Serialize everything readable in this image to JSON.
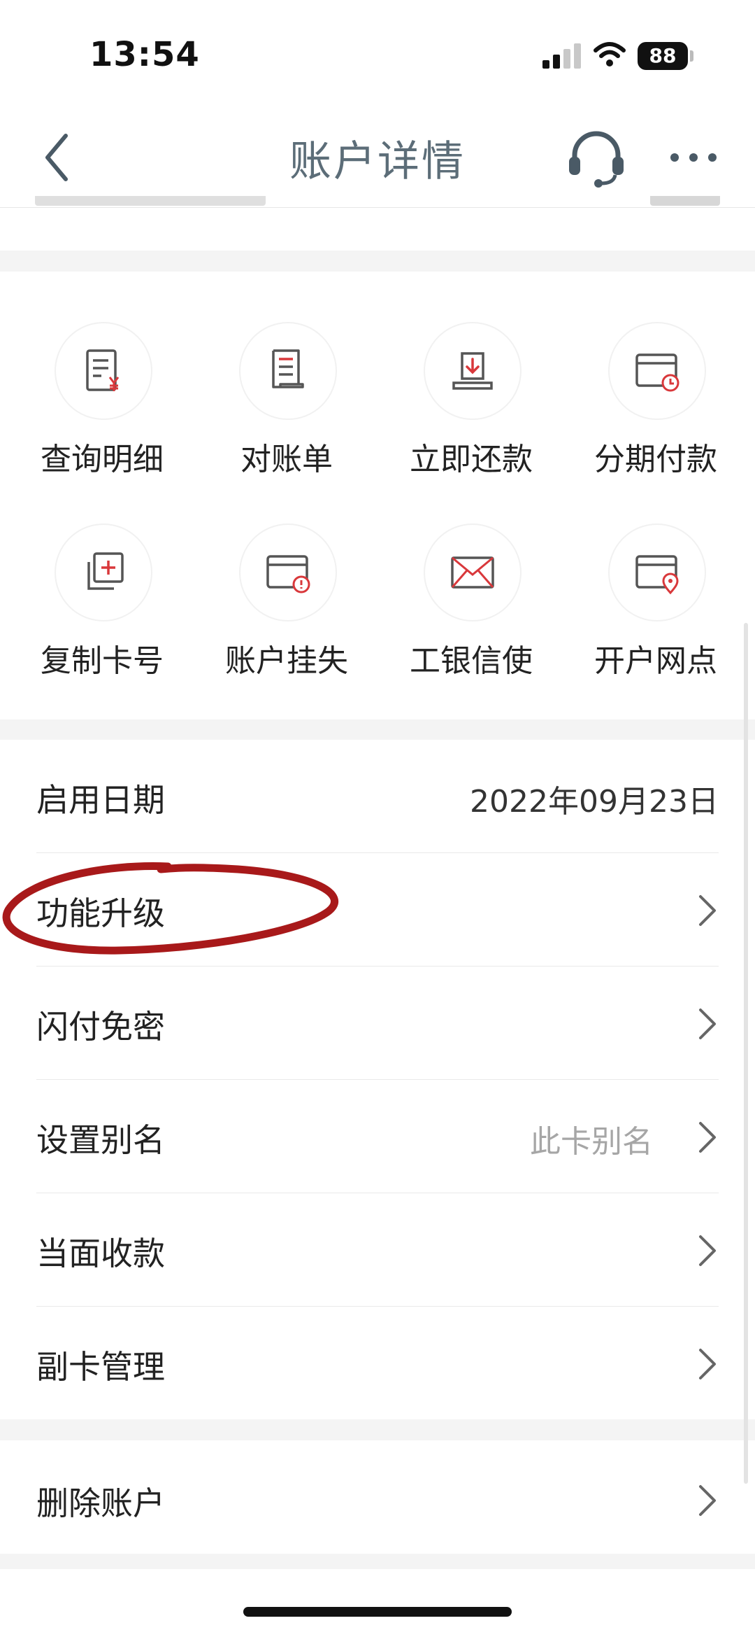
{
  "status_bar": {
    "time": "13:54",
    "battery": "88"
  },
  "nav": {
    "title": "账户详情",
    "back_icon": "chevron-left-icon",
    "support_icon": "headset-icon",
    "more_icon": "more-dots-icon"
  },
  "quick_actions": [
    {
      "label": "查询明细",
      "icon": "statement-yuan-icon"
    },
    {
      "label": "对账单",
      "icon": "bill-document-icon"
    },
    {
      "label": "立即还款",
      "icon": "repay-download-icon"
    },
    {
      "label": "分期付款",
      "icon": "card-clock-icon"
    },
    {
      "label": "复制卡号",
      "icon": "copy-plus-icon"
    },
    {
      "label": "账户挂失",
      "icon": "card-alert-icon"
    },
    {
      "label": "工银信使",
      "icon": "envelope-icon"
    },
    {
      "label": "开户网点",
      "icon": "card-location-icon"
    }
  ],
  "details": {
    "start_date": {
      "label": "启用日期",
      "value": "2022年09月23日"
    },
    "upgrade": {
      "label": "功能升级"
    },
    "flash_pay": {
      "label": "闪付免密"
    },
    "alias": {
      "label": "设置别名",
      "hint": "此卡别名"
    },
    "collect": {
      "label": "当面收款"
    },
    "sub_card": {
      "label": "副卡管理"
    },
    "delete": {
      "label": "删除账户"
    }
  },
  "colors": {
    "accent_red": "#d9383b",
    "annotation_red": "#a8191a",
    "title_gray": "#5c6d78"
  }
}
